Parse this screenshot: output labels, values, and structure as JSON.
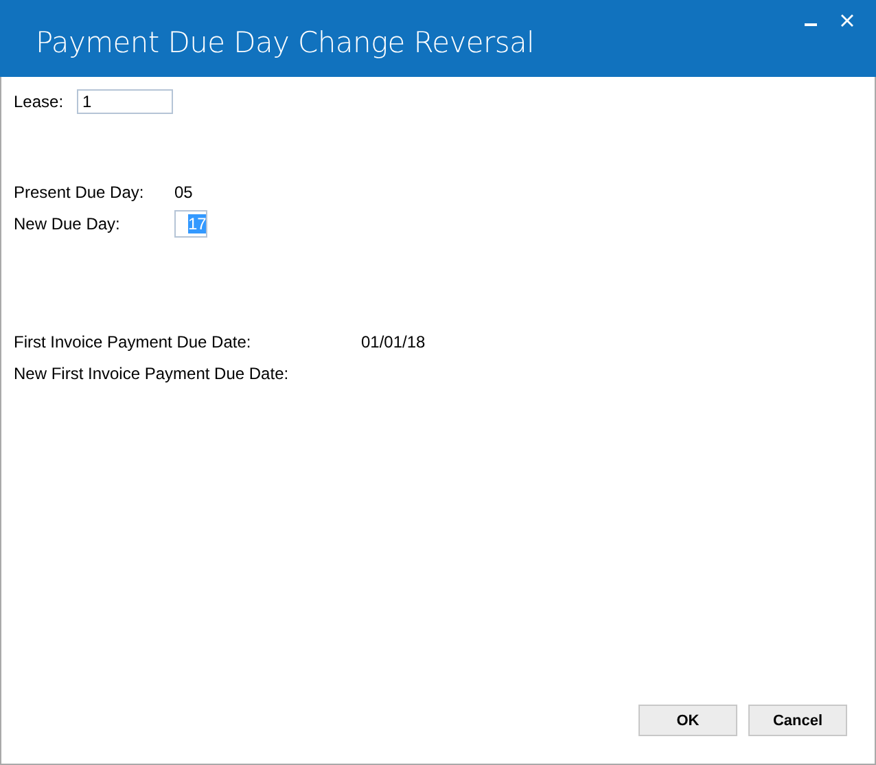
{
  "window": {
    "title": "Payment Due Day Change Reversal"
  },
  "lease": {
    "label": "Lease:",
    "value": "1"
  },
  "present_due_day": {
    "label": "Present Due Day:",
    "value": "05"
  },
  "new_due_day": {
    "label": "New Due Day:",
    "value": "17",
    "text_selected": true
  },
  "first_invoice_payment_due_date": {
    "label": "First Invoice Payment Due Date:",
    "value": "01/01/18"
  },
  "new_first_invoice_payment_due_date": {
    "label": "New First Invoice Payment Due Date:"
  },
  "buttons": [
    {
      "label": "OK"
    },
    {
      "label": "Cancel"
    }
  ]
}
